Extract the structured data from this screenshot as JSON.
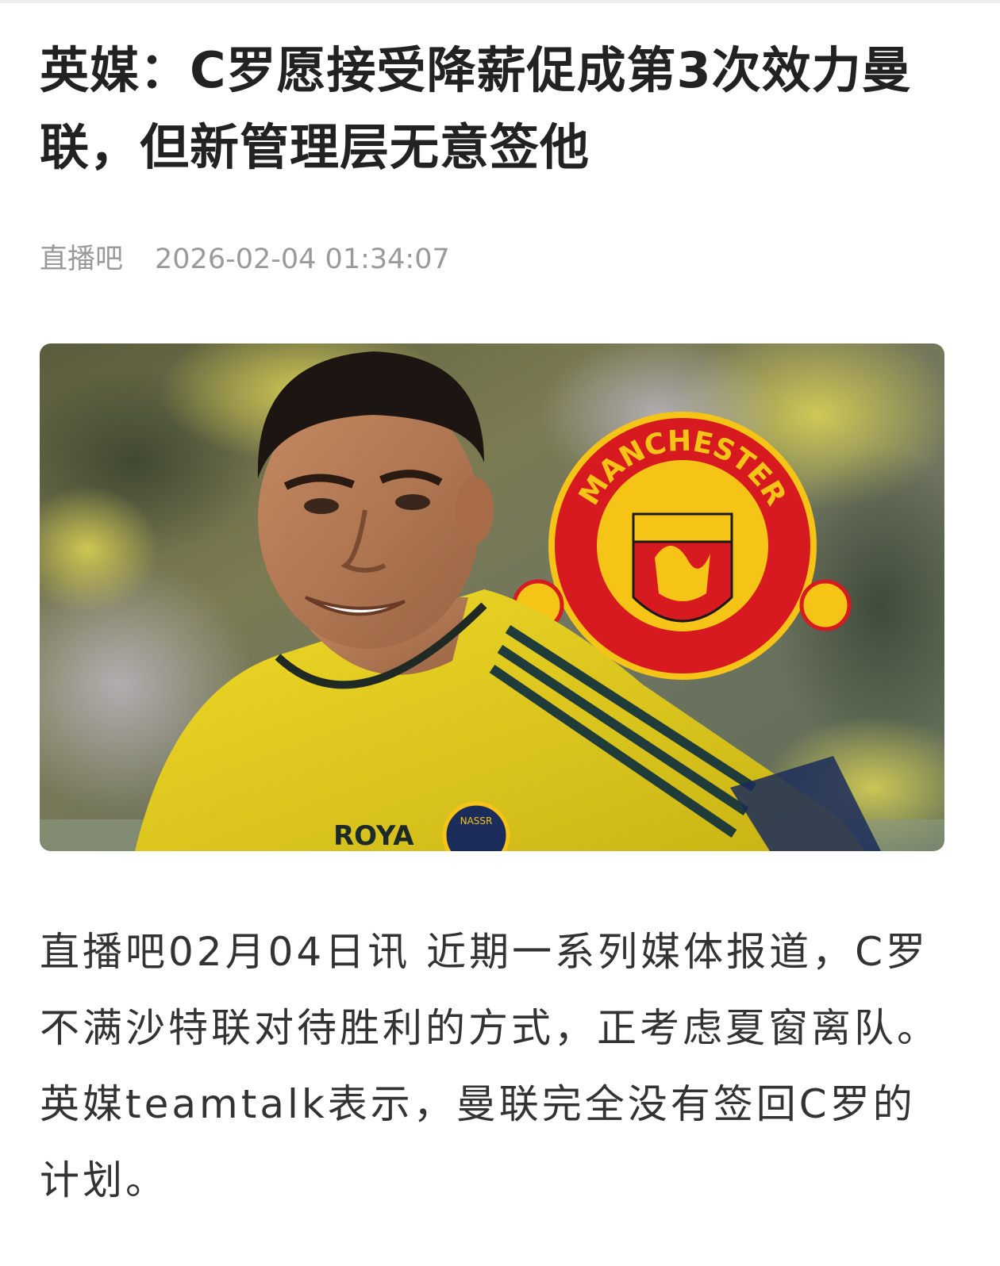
{
  "article": {
    "title": "英媒：C罗愿接受降薪促成第3次效力曼联，但新管理层无意签他",
    "source": "直播吧",
    "timestamp": "2026-02-04 01:34:07",
    "image": {
      "badge_text": "MANCHESTER",
      "jersey_text": "ROYA",
      "badge_subtext": "NASSR"
    },
    "body": "直播吧02月04日讯 近期一系列媒体报道，C罗不满沙特联对待胜利的方式，正考虑夏窗离队。英媒teamtalk表示，曼联完全没有签回C罗的计划。"
  },
  "colors": {
    "title": "#222222",
    "meta": "#9a9a9a",
    "body": "#333333",
    "jersey_yellow": "#e8d21e",
    "badge_red": "#d71920",
    "badge_gold": "#f6c417"
  }
}
